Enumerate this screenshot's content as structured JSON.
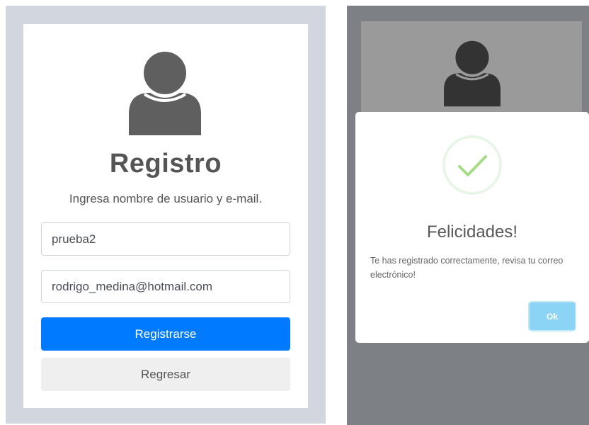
{
  "register": {
    "title": "Registro",
    "subtitle": "Ingresa nombre de usuario y e-mail.",
    "username_value": "prueba2",
    "email_value": "rodrigo_medina@hotmail.com",
    "submit_label": "Registrarse",
    "back_label": "Regresar",
    "avatar_icon": "user-icon"
  },
  "dialog": {
    "title": "Felicidades!",
    "message": "Te has registrado correctamente, revisa tu correo electrónico!",
    "ok_label": "Ok",
    "icon": "success-check-icon"
  },
  "colors": {
    "primary": "#007bff",
    "background": "#d2d6de",
    "overlay": "#7d8085",
    "success": "#a5dc86",
    "ok_button": "#8cd4f5"
  }
}
